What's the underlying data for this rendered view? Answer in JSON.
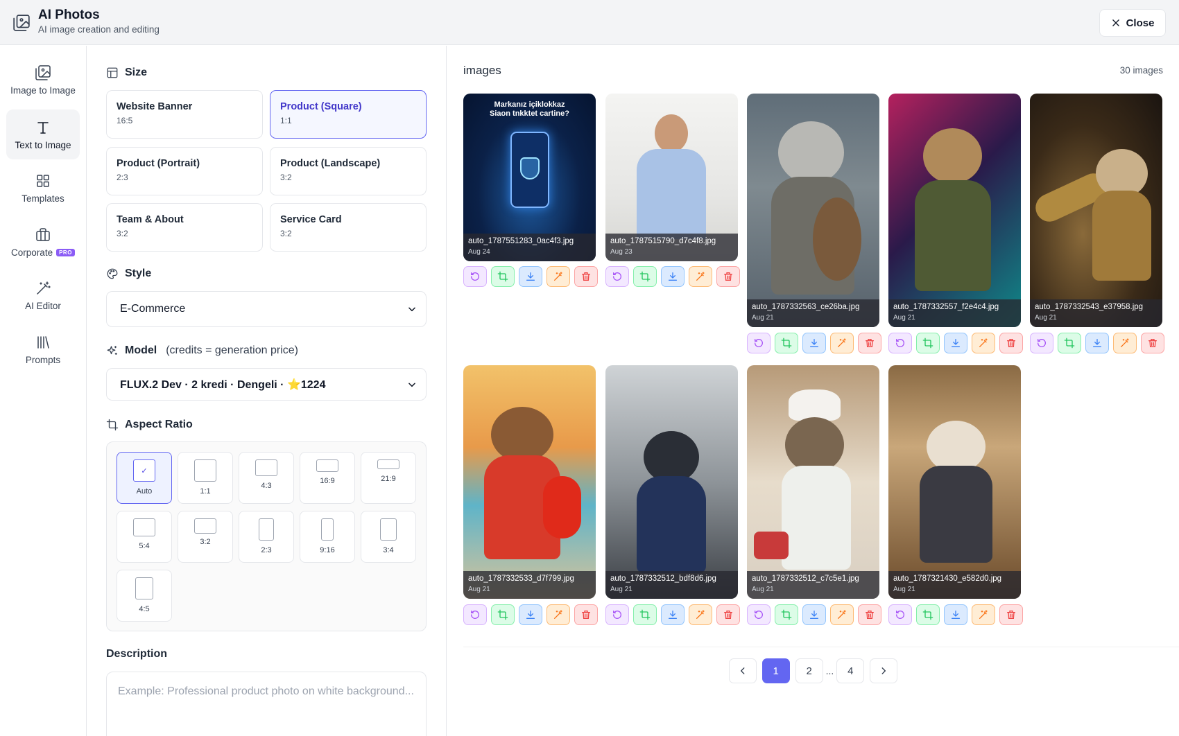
{
  "header": {
    "title": "AI Photos",
    "subtitle": "AI image creation and editing",
    "close_label": "Close"
  },
  "nav": {
    "items": [
      {
        "label": "Image to Image",
        "icon": "image-icon",
        "active": false
      },
      {
        "label": "Text to Image",
        "icon": "text-icon",
        "active": true
      },
      {
        "label": "Templates",
        "icon": "grid-icon",
        "active": false
      },
      {
        "label": "Corporate",
        "icon": "briefcase-icon",
        "active": false,
        "badge": "PRO"
      },
      {
        "label": "AI Editor",
        "icon": "magic-wand-icon",
        "active": false
      },
      {
        "label": "Prompts",
        "icon": "library-icon",
        "active": false
      }
    ]
  },
  "settings": {
    "size": {
      "heading": "Size",
      "options": [
        {
          "name": "Website Banner",
          "ratio": "16:5",
          "selected": false
        },
        {
          "name": "Product (Square)",
          "ratio": "1:1",
          "selected": true
        },
        {
          "name": "Product (Portrait)",
          "ratio": "2:3",
          "selected": false
        },
        {
          "name": "Product (Landscape)",
          "ratio": "3:2",
          "selected": false
        },
        {
          "name": "Team & About",
          "ratio": "3:2",
          "selected": false
        },
        {
          "name": "Service Card",
          "ratio": "3:2",
          "selected": false
        }
      ]
    },
    "style": {
      "heading": "Style",
      "value": "E-Commerce"
    },
    "model": {
      "heading": "Model",
      "note": "(credits = generation price)",
      "value": "FLUX.2 Dev · 2 kredi · Dengeli · ⭐1224"
    },
    "aspect": {
      "heading": "Aspect Ratio",
      "options": [
        "Auto",
        "1:1",
        "4:3",
        "16:9",
        "21:9",
        "5:4",
        "3:2",
        "2:3",
        "9:16",
        "3:4",
        "4:5"
      ],
      "selected": "Auto"
    },
    "description": {
      "heading": "Description",
      "placeholder": "Example: Professional product photo on white background..."
    }
  },
  "gallery": {
    "title": "images",
    "count": "30 images",
    "banner_text": "Markanız içiklokkaz Siaon tnkktet cartine?",
    "images": [
      {
        "filename": "auto_1787551283_0ac4f3.jpg",
        "date": "Aug 24"
      },
      {
        "filename": "auto_1787515790_d7c4f8.jpg",
        "date": "Aug 23"
      },
      {
        "filename": "auto_1787332563_ce26ba.jpg",
        "date": "Aug 21"
      },
      {
        "filename": "auto_1787332557_f2e4c4.jpg",
        "date": "Aug 21"
      },
      {
        "filename": "auto_1787332543_e37958.jpg",
        "date": "Aug 21"
      },
      {
        "filename": "auto_1787332533_d7f799.jpg",
        "date": "Aug 21"
      },
      {
        "filename": "auto_1787332512_bdf8d6.jpg",
        "date": "Aug 21"
      },
      {
        "filename": "auto_1787332512_c7c5e1.jpg",
        "date": "Aug 21"
      },
      {
        "filename": "auto_1787321430_e582d0.jpg",
        "date": "Aug 21"
      }
    ],
    "pagination": {
      "pages": [
        "1",
        "2",
        "...",
        "4"
      ],
      "current": "1"
    }
  },
  "colors": {
    "accent": "#6366f1",
    "retry": "#a855f7",
    "crop": "#22c55e",
    "download": "#3b82f6",
    "edit": "#f97316",
    "delete": "#ef4444"
  }
}
